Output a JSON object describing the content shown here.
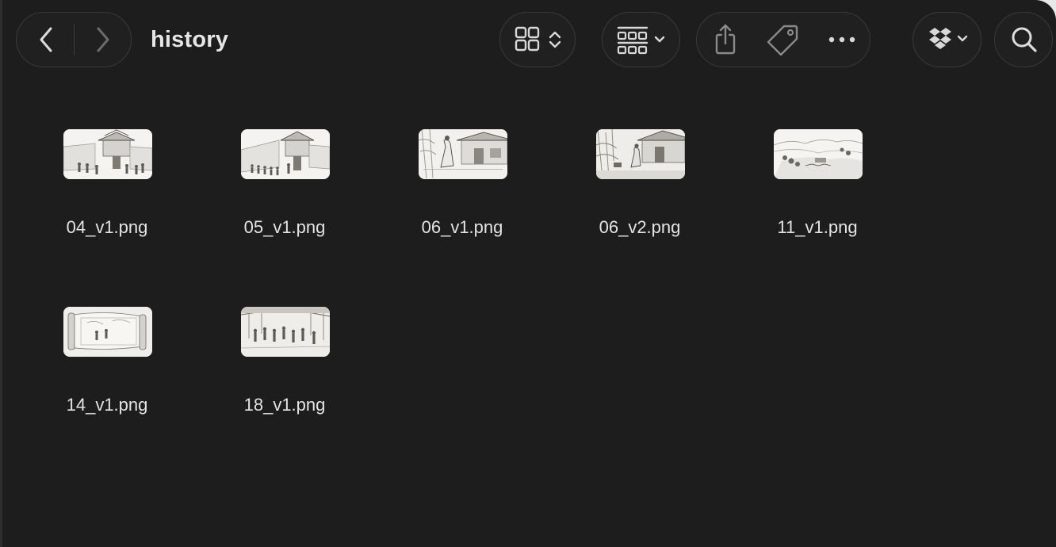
{
  "toolbar": {
    "folder_title": "history",
    "icons": {
      "back": "chevron-left-icon",
      "forward": "chevron-right-icon",
      "view": "grid-view-icon",
      "group": "group-by-icon",
      "share": "share-icon",
      "tag": "tag-icon",
      "more": "more-icon",
      "dropbox": "dropbox-icon",
      "search": "search-icon"
    }
  },
  "files": [
    {
      "name": "04_v1.png",
      "scene": "city-gate"
    },
    {
      "name": "05_v1.png",
      "scene": "city-gate"
    },
    {
      "name": "06_v1.png",
      "scene": "courtyard"
    },
    {
      "name": "06_v2.png",
      "scene": "courtyard"
    },
    {
      "name": "11_v1.png",
      "scene": "landscape"
    },
    {
      "name": "14_v1.png",
      "scene": "scroll"
    },
    {
      "name": "18_v1.png",
      "scene": "crowd"
    }
  ],
  "colors": {
    "window_bg": "#1d1d1d",
    "text": "#e4e4e4",
    "icon": "#d8d8d8"
  }
}
